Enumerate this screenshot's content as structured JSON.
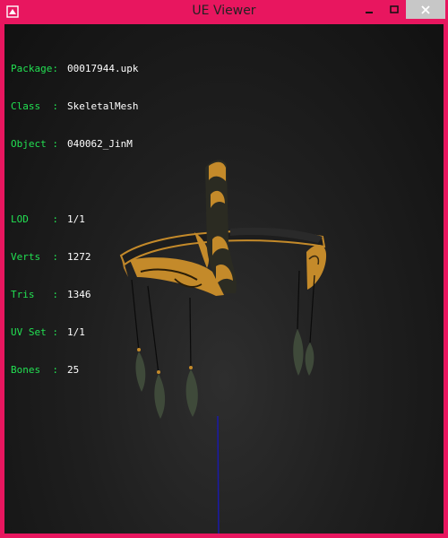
{
  "window": {
    "title": "UE Viewer"
  },
  "titlebar": {
    "minimize_icon": "minimize-icon",
    "maximize_icon": "maximize-icon",
    "close_icon": "close-icon"
  },
  "info": {
    "package": {
      "key": "Package:",
      "value": "00017944.upk"
    },
    "class": {
      "key": "Class  :",
      "value": "SkeletalMesh"
    },
    "object": {
      "key": "Object :",
      "value": "040062_JinM"
    },
    "lod": {
      "key": "LOD    :",
      "value": "1/1"
    },
    "verts": {
      "key": "Verts  :",
      "value": "1272"
    },
    "tris": {
      "key": "Tris   :",
      "value": "1346"
    },
    "uvset": {
      "key": "UV Set :",
      "value": "1/1"
    },
    "bones": {
      "key": "Bones  :",
      "value": "25"
    }
  },
  "colors": {
    "frame": "#e8165f",
    "label": "#22e052",
    "value": "#ffffff",
    "mesh_gold": "#c48a2a",
    "axis": "#1a1aa8"
  }
}
